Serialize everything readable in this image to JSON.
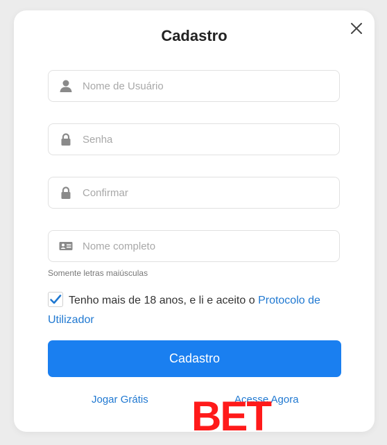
{
  "modal": {
    "title": "Cadastro",
    "close_icon": "close-icon"
  },
  "fields": {
    "username": {
      "placeholder": "Nome de Usuário",
      "value": "",
      "icon": "user-icon"
    },
    "password": {
      "placeholder": "Senha",
      "value": "",
      "icon": "lock-icon"
    },
    "confirm": {
      "placeholder": "Confirmar",
      "value": "",
      "icon": "lock-icon"
    },
    "fullname": {
      "placeholder": "Nome completo",
      "value": "",
      "icon": "id-card-icon"
    }
  },
  "hint": "Somente letras maiúsculas",
  "terms": {
    "checked": true,
    "text": "Tenho mais de 18 anos, e li e aceito o ",
    "link_text": "Protocolo de Utilizador"
  },
  "submit_label": "Cadastro",
  "links": {
    "play_free": "Jogar Grátis",
    "login_now": "Acesse Agora"
  },
  "watermark": "BET",
  "colors": {
    "accent": "#1a7ff0",
    "link": "#1f78d1",
    "watermark": "#ff1a1a"
  }
}
